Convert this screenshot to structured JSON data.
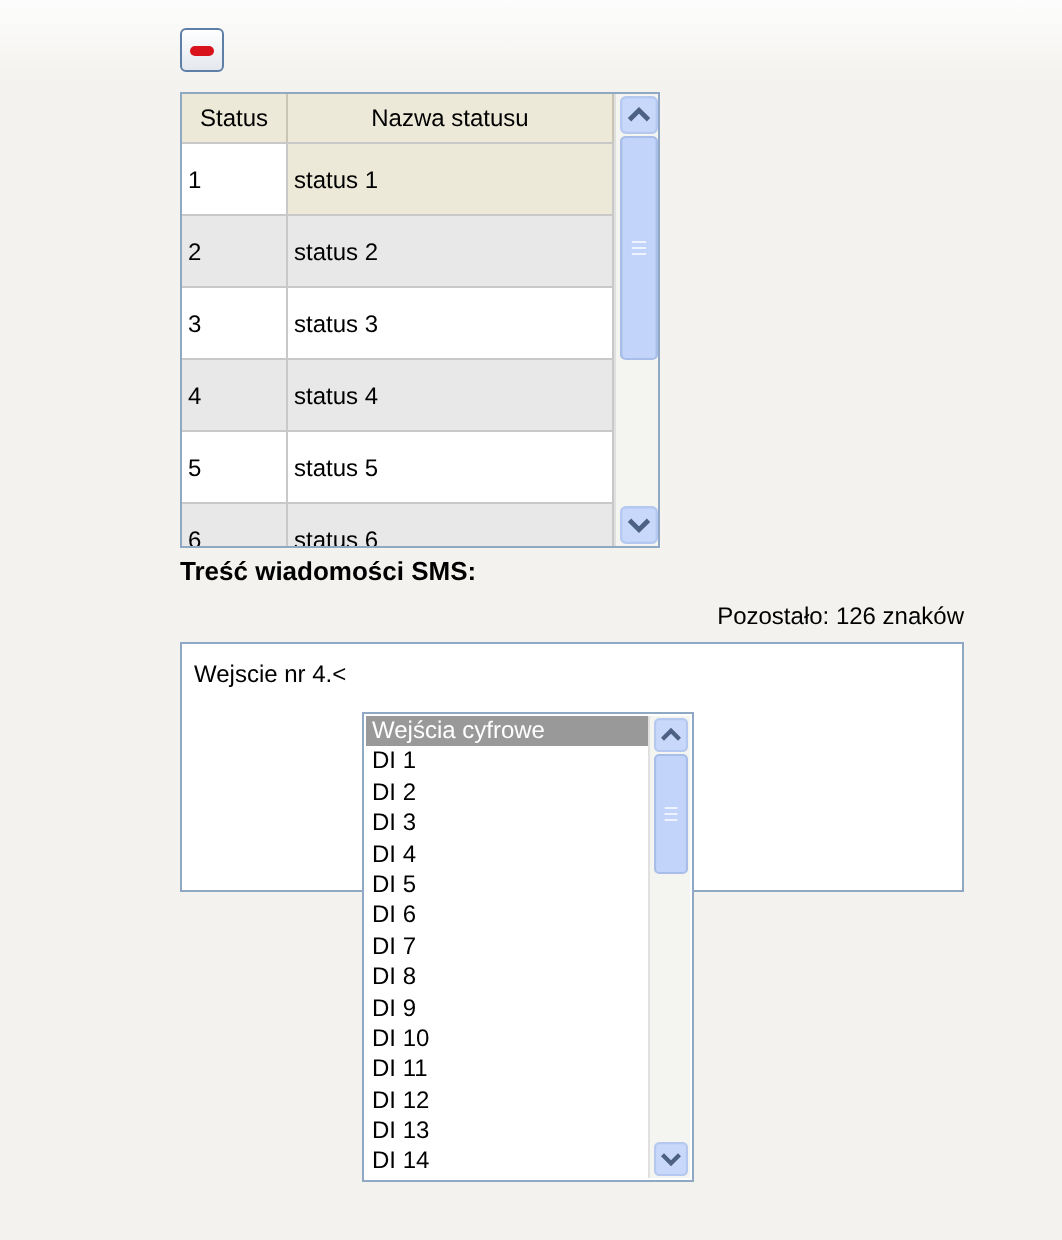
{
  "table": {
    "columns": [
      "Status",
      "Nazwa statusu"
    ],
    "rows": [
      {
        "status": "1",
        "name": "status 1",
        "selected": true
      },
      {
        "status": "2",
        "name": "status 2",
        "selected": false
      },
      {
        "status": "3",
        "name": "status 3",
        "selected": false
      },
      {
        "status": "4",
        "name": "status 4",
        "selected": false
      },
      {
        "status": "5",
        "name": "status 5",
        "selected": false
      },
      {
        "status": "6",
        "name": "status 6",
        "selected": false
      }
    ]
  },
  "sms": {
    "label": "Treść wiadomości SMS:",
    "remaining": "Pozostało: 126 znaków",
    "value": "Wejscie nr 4.<"
  },
  "dropdown": {
    "items": [
      {
        "label": "Wejścia cyfrowe",
        "selected": true
      },
      {
        "label": "DI 1",
        "selected": false
      },
      {
        "label": "DI 2",
        "selected": false
      },
      {
        "label": "DI 3",
        "selected": false
      },
      {
        "label": "DI 4",
        "selected": false
      },
      {
        "label": "DI 5",
        "selected": false
      },
      {
        "label": "DI 6",
        "selected": false
      },
      {
        "label": "DI 7",
        "selected": false
      },
      {
        "label": "DI 8",
        "selected": false
      },
      {
        "label": "DI 9",
        "selected": false
      },
      {
        "label": "DI 10",
        "selected": false
      },
      {
        "label": "DI 11",
        "selected": false
      },
      {
        "label": "DI 12",
        "selected": false
      },
      {
        "label": "DI 13",
        "selected": false
      },
      {
        "label": "DI 14",
        "selected": false
      }
    ]
  }
}
